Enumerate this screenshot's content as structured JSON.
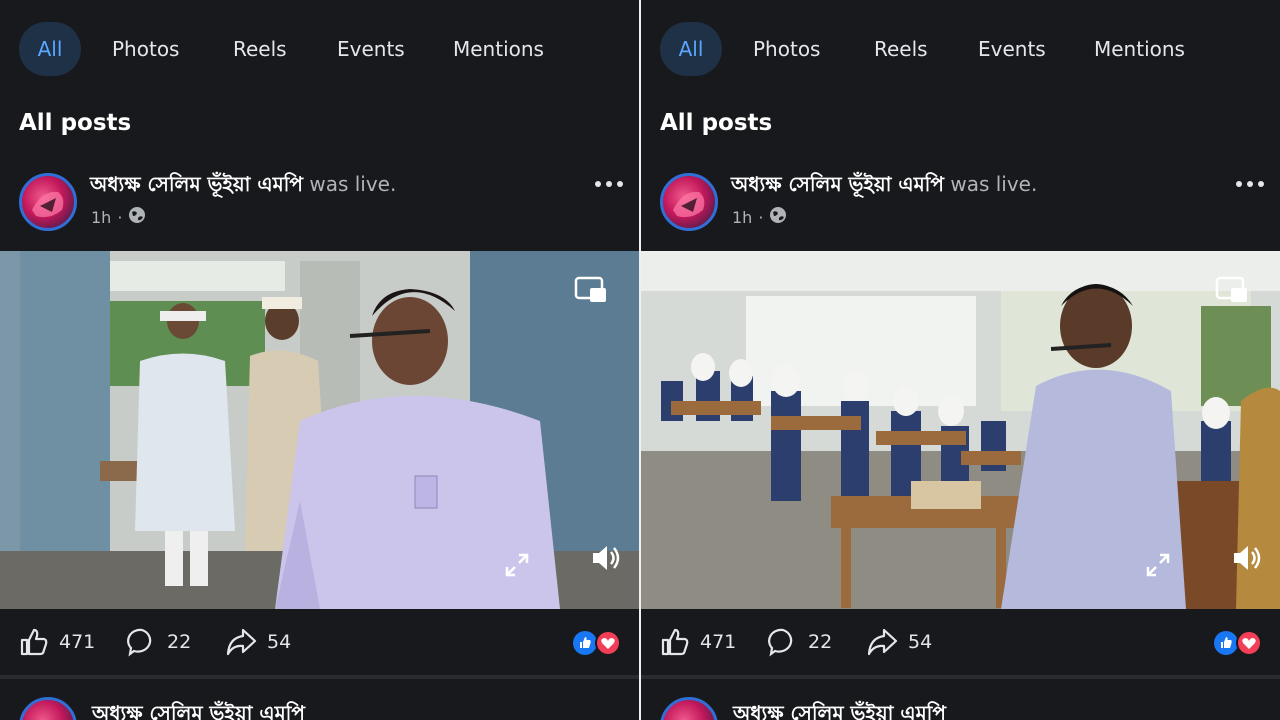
{
  "panels": [
    {
      "tabs": [
        {
          "label": "All",
          "active": true
        },
        {
          "label": "Photos"
        },
        {
          "label": "Reels"
        },
        {
          "label": "Events"
        },
        {
          "label": "Mentions"
        }
      ],
      "section_title": "All posts",
      "post": {
        "author": "অধ্যক্ষ সেলিম ভূঁইয়া এমপি",
        "action_text": "was live.",
        "time": "1h",
        "audience_icon": "globe-icon",
        "likes": "471",
        "comments": "22",
        "shares": "54",
        "reaction_icons": [
          "like-reaction-icon",
          "love-reaction-icon"
        ]
      },
      "next_post_author": "অধ্যক্ষ সেলিম ভূঁইয়া এমপি"
    },
    {
      "tabs": [
        {
          "label": "All",
          "active": true
        },
        {
          "label": "Photos"
        },
        {
          "label": "Reels"
        },
        {
          "label": "Events"
        },
        {
          "label": "Mentions"
        }
      ],
      "section_title": "All posts",
      "post": {
        "author": "অধ্যক্ষ সেলিম ভূঁইয়া এমপি",
        "action_text": "was live.",
        "time": "1h",
        "audience_icon": "globe-icon",
        "likes": "471",
        "comments": "22",
        "shares": "54",
        "reaction_icons": [
          "like-reaction-icon",
          "love-reaction-icon"
        ]
      },
      "next_post_author": "অধ্যক্ষ সেলিম ভূঁইয়া এমপি"
    }
  ],
  "colors": {
    "background": "#18191c",
    "active_tab_bg": "#1f3147",
    "active_tab_text": "#5aa7ff",
    "like_blue": "#1877f2",
    "love_red": "#f33e58"
  }
}
